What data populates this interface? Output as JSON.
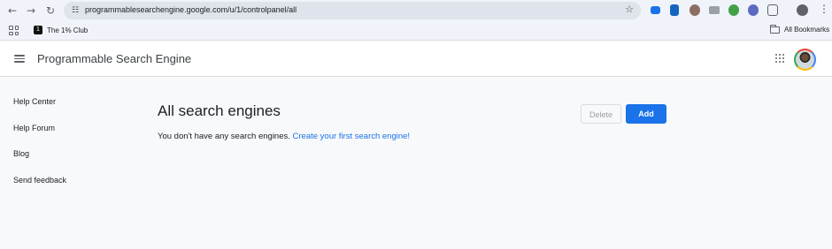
{
  "browser": {
    "url": "programmablesearchengine.google.com/u/1/controlpanel/all",
    "bookmark": "The 1% Club",
    "bookmark_favicon": "1",
    "all_bookmarks": "All Bookmarks",
    "icons": [
      "back-icon",
      "forward-icon",
      "reload-icon",
      "site-info-icon",
      "star-icon",
      "extensions-icon",
      "menu-icon"
    ]
  },
  "header": {
    "title": "Programmable Search Engine"
  },
  "sidebar": {
    "items": [
      {
        "label": "Help Center"
      },
      {
        "label": "Help Forum"
      },
      {
        "label": "Blog"
      },
      {
        "label": "Send feedback"
      }
    ]
  },
  "main": {
    "title": "All search engines",
    "empty_message": "You don't have any search engines.",
    "create_link": "Create your first search engine!",
    "delete_label": "Delete",
    "add_label": "Add"
  },
  "colors": {
    "accent": "#1a73e8",
    "background": "#f8f9fa"
  }
}
